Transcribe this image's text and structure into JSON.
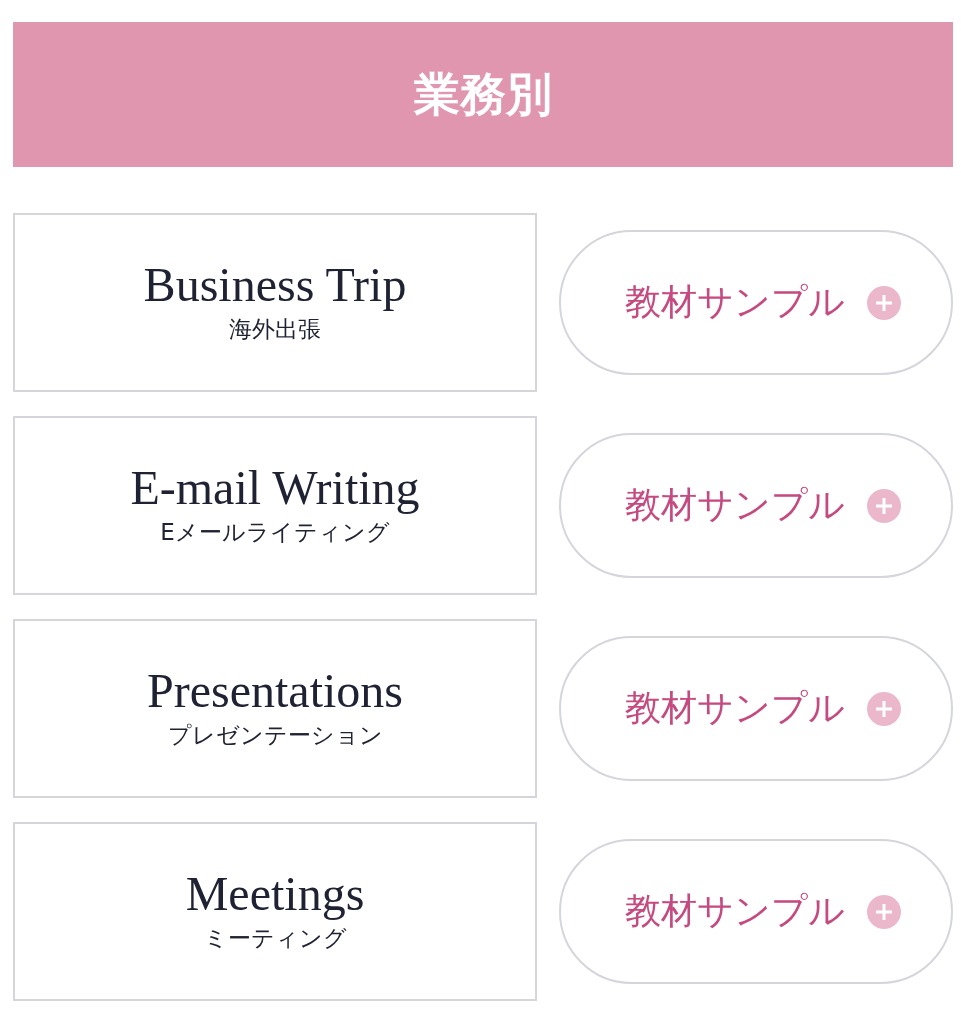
{
  "header": {
    "title": "業務別"
  },
  "items": [
    {
      "title": "Business Trip",
      "subtitle": "海外出張",
      "button": "教材サンプル"
    },
    {
      "title": "E-mail Writing",
      "subtitle": "Eメールライティング",
      "button": "教材サンプル"
    },
    {
      "title": "Presentations",
      "subtitle": "プレゼンテーション",
      "button": "教材サンプル"
    },
    {
      "title": "Meetings",
      "subtitle": "ミーティング",
      "button": "教材サンプル"
    }
  ]
}
